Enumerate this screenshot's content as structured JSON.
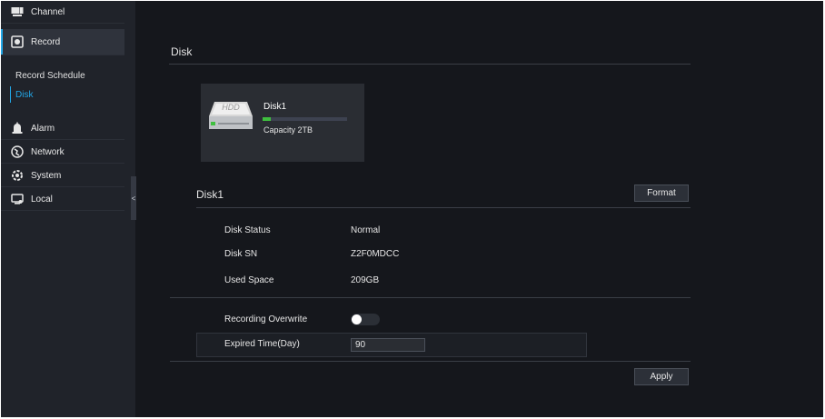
{
  "sidebar": {
    "items": [
      {
        "label": "Channel",
        "icon": "channel-icon"
      },
      {
        "label": "Record",
        "icon": "record-icon"
      },
      {
        "label": "Alarm",
        "icon": "alarm-icon"
      },
      {
        "label": "Network",
        "icon": "network-icon"
      },
      {
        "label": "System",
        "icon": "system-icon"
      },
      {
        "label": "Local",
        "icon": "local-icon"
      }
    ],
    "subitems": [
      {
        "label": "Record Schedule"
      },
      {
        "label": "Disk"
      }
    ],
    "collapse_glyph": "<"
  },
  "main": {
    "title": "Disk",
    "disk_card": {
      "badge": "HDD",
      "name": "Disk1",
      "capacity": "Capacity 2TB",
      "usage_fraction": 0.1
    },
    "disk_panel": {
      "title": "Disk1",
      "format_label": "Format",
      "rows": [
        {
          "label": "Disk Status",
          "value": "Normal"
        },
        {
          "label": "Disk SN",
          "value": "Z2F0MDCC"
        },
        {
          "label": "Used Space",
          "value": "209GB"
        }
      ],
      "overwrite_label": "Recording Overwrite",
      "overwrite_on": false,
      "expired_label": "Expired Time(Day)",
      "expired_value": "90",
      "apply_label": "Apply"
    }
  },
  "colors": {
    "accent": "#22a6e6",
    "usage_fill": "#3fbf3f"
  }
}
